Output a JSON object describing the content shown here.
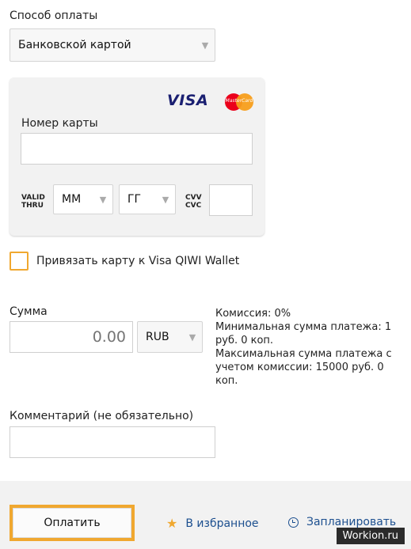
{
  "payment_method": {
    "label": "Способ оплаты",
    "selected": "Банковской картой"
  },
  "card_form": {
    "brand_visa": "VISA",
    "brand_mastercard": "MasterCard",
    "card_number_label": "Номер карты",
    "card_number_value": "",
    "valid_thru_line1": "VALID",
    "valid_thru_line2": "THRU",
    "month_selected": "ММ",
    "year_selected": "ГГ",
    "cvv_line1": "CVV",
    "cvv_line2": "CVC",
    "cvv_value": ""
  },
  "bind_card": {
    "label": "Привязать карту к Visa QIWI Wallet",
    "checked": false
  },
  "amount": {
    "label": "Сумма",
    "placeholder": "0.00",
    "currency": "RUB"
  },
  "commission_info": {
    "line1": "Комиссия: 0%",
    "line2": "Минимальная сумма платежа: 1 руб. 0 коп.",
    "line3": "Максимальная сумма платежа с учетом комиссии: 15000 руб. 0 коп."
  },
  "comment": {
    "label": "Комментарий (не обязательно)",
    "value": ""
  },
  "footer": {
    "pay_button": "Оплатить",
    "favorite_link": "В избранное",
    "schedule_link": "Запланировать"
  },
  "watermark": "Workion.ru",
  "colors": {
    "accent": "#f0a830",
    "link": "#1c4f8f",
    "visa": "#1a1f71"
  }
}
